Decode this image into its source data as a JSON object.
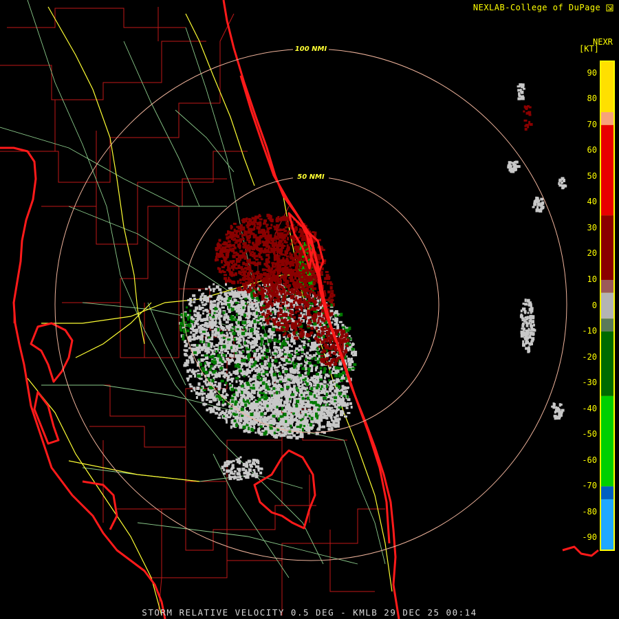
{
  "header": {
    "source": "NEXLAB-College of DuPage",
    "logo_icon": "cod-logo-icon"
  },
  "footer": {
    "caption": "STORM RELATIVE VELOCITY 0.5 DEG - KMLB 29 DEC 25 00:14"
  },
  "legend": {
    "product": "NEXR",
    "unit": "[KT]",
    "ticks": [
      "90",
      "80",
      "70",
      "60",
      "50",
      "40",
      "30",
      "20",
      "10",
      "0",
      "-10",
      "-20",
      "-30",
      "-40",
      "-50",
      "-60",
      "-70",
      "-80",
      "-90"
    ],
    "range": [
      -95,
      95
    ],
    "bands": [
      {
        "from": 75,
        "to": 95,
        "color": "#ffe000"
      },
      {
        "from": 70,
        "to": 75,
        "color": "#f7a37a"
      },
      {
        "from": 35,
        "to": 70,
        "color": "#e80000"
      },
      {
        "from": 10,
        "to": 35,
        "color": "#8a0000"
      },
      {
        "from": 5,
        "to": 10,
        "color": "#9c5a5a"
      },
      {
        "from": -5,
        "to": 5,
        "color": "#b4b4b4"
      },
      {
        "from": -10,
        "to": -5,
        "color": "#5a7a5a"
      },
      {
        "from": -35,
        "to": -10,
        "color": "#006a00"
      },
      {
        "from": -70,
        "to": -35,
        "color": "#00d000"
      },
      {
        "from": -75,
        "to": -70,
        "color": "#0060c0"
      },
      {
        "from": -95,
        "to": -75,
        "color": "#20a8ff"
      }
    ]
  },
  "range_rings": [
    {
      "label": "100 NMI",
      "color": "#f0b49c"
    },
    {
      "label": "50 NMI",
      "color": "#f0b49c"
    }
  ],
  "colors": {
    "coastline": "#ff1a1a",
    "county_lines": "#c01818",
    "highways": "#ffff33",
    "roads": "#8ccc8c",
    "echo_outbound": "#8a0000",
    "echo_inbound": "#007a00",
    "echo_near_zero": "#c8c8c8"
  }
}
